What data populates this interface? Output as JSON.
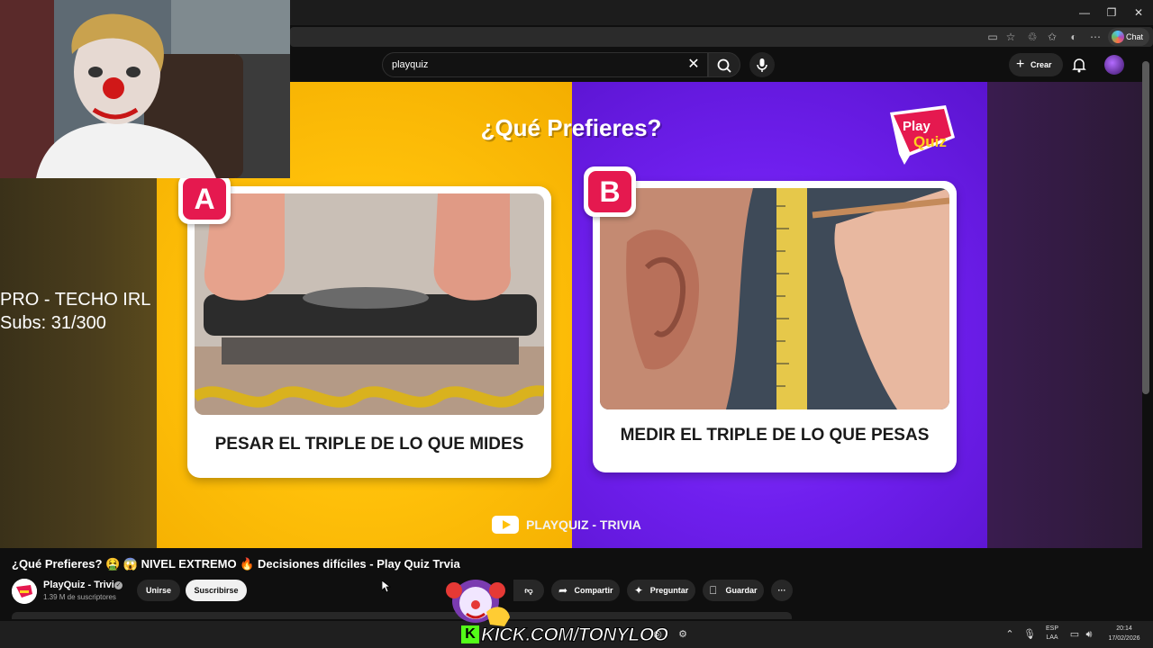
{
  "browser": {
    "window_controls": [
      "—",
      "❐",
      "✕"
    ],
    "chat_label": "Chat"
  },
  "search": {
    "value": "playquiz",
    "clear_icon": "close-icon",
    "search_icon": "search-icon",
    "mic_icon": "mic-icon"
  },
  "header": {
    "create_label": "Crear"
  },
  "video": {
    "title_overlay": "¿Qué Prefieres?",
    "logo_top": "Play",
    "logo_bottom": "Quiz",
    "option_a_badge": "A",
    "option_a_text": "PESAR EL TRIPLE DE LO QUE MIDES",
    "option_b_badge": "B",
    "option_b_text": "MEDIR EL TRIPLE DE LO QUE PESAS",
    "watermark": "PLAYQUIZ - TRIVIA",
    "colors": {
      "left_bg": "#ffc10a",
      "right_bg": "#6f1fee",
      "badge": "#e5194f"
    }
  },
  "stream_overlay": {
    "line1": "PRO - TECHO IRL",
    "line2": "Subs: 31/300",
    "kick_text": "KICK.COM/TONYLOO"
  },
  "watch": {
    "title": "¿Qué Prefieres? 🤮 😱 NIVEL EXTREMO 🔥 Decisiones difíciles - Play Quiz Trvia",
    "channel_name": "PlayQuiz - Trivia",
    "subscribers": "1.39 M de suscriptores",
    "join_label": "Unirse",
    "subscribe_label": "Suscribirse",
    "like_count": "8 K",
    "share_label": "Compartir",
    "ask_label": "Preguntar",
    "save_label": "Guardar",
    "more_label": "···"
  },
  "taskbar": {
    "lang_line1": "ESP",
    "lang_line2": "LAA",
    "time": "20:14",
    "date": "17/02/2026"
  }
}
